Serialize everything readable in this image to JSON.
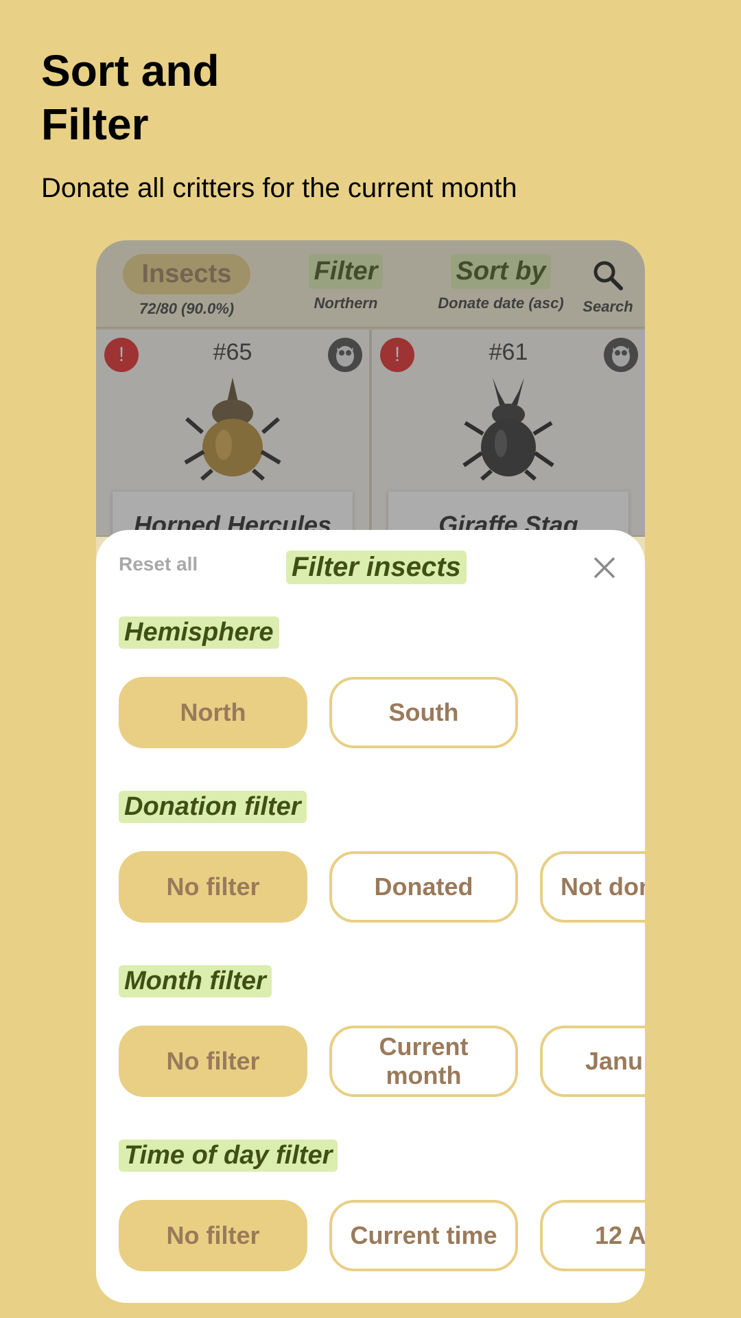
{
  "promo": {
    "title": "Sort and Filter",
    "subtitle": "Donate all critters for the current month"
  },
  "appbar": {
    "category_label": "Insects",
    "progress_text": "72/80 (90.0%)",
    "filter_label": "Filter",
    "filter_value": "Northern",
    "sort_label": "Sort by",
    "sort_value": "Donate date (asc)",
    "search_label": "Search"
  },
  "cards": [
    {
      "number": "#65",
      "alert": "!",
      "name": "Horned Hercules"
    },
    {
      "number": "#61",
      "alert": "!",
      "name": "Giraffe Stag"
    }
  ],
  "sheet": {
    "reset_label": "Reset all",
    "title": "Filter insects",
    "sections": [
      {
        "label": "Hemisphere",
        "options": [
          "North",
          "South"
        ]
      },
      {
        "label": "Donation filter",
        "options": [
          "No filter",
          "Donated",
          "Not don"
        ]
      },
      {
        "label": "Month filter",
        "options": [
          "No filter",
          "Current month",
          "Janu"
        ]
      },
      {
        "label": "Time of day filter",
        "options": [
          "No filter",
          "Current time",
          "12 A"
        ]
      }
    ]
  },
  "colors": {
    "background": "#e8d186",
    "chip_selected": "#e8cf84",
    "label_highlight": "#dcedb0",
    "label_text": "#3f5014",
    "alert": "#e32323"
  },
  "icons": [
    "search-icon",
    "owl-icon",
    "close-icon",
    "beetle-icon"
  ]
}
